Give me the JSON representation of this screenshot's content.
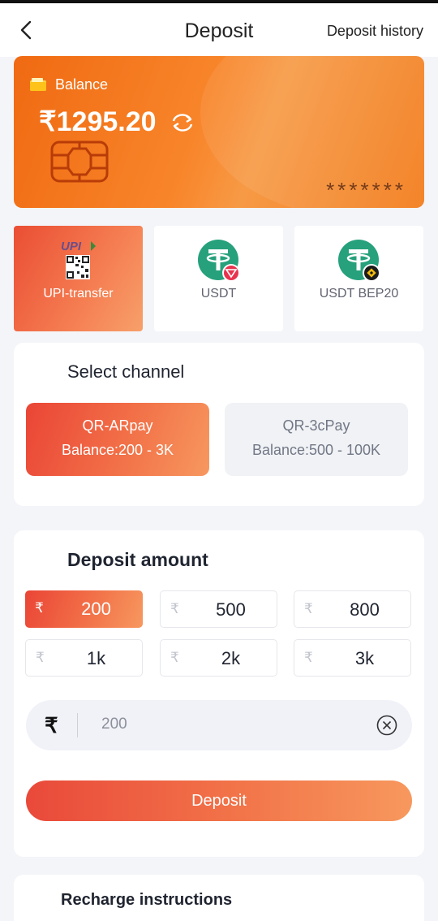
{
  "header": {
    "title": "Deposit",
    "history_label": "Deposit history"
  },
  "balance_card": {
    "label": "Balance",
    "amount": "₹1295.20",
    "masked_number": "*******"
  },
  "payment_methods": [
    {
      "label": "UPI-transfer",
      "logo_text": "UPI",
      "selected": true
    },
    {
      "label": "USDT",
      "selected": false
    },
    {
      "label": "USDT BEP20",
      "selected": false
    }
  ],
  "channel_section": {
    "title": "Select channel",
    "channels": [
      {
        "name": "QR-ARpay",
        "balance": "Balance:200 - 3K",
        "selected": true
      },
      {
        "name": "QR-3cPay",
        "balance": "Balance:500 - 100K",
        "selected": false
      }
    ]
  },
  "amount_section": {
    "title": "Deposit amount",
    "currency_symbol": "₹",
    "options": [
      {
        "value": "200",
        "selected": true
      },
      {
        "value": "500",
        "selected": false
      },
      {
        "value": "800",
        "selected": false
      },
      {
        "value": "1k",
        "selected": false
      },
      {
        "value": "2k",
        "selected": false
      },
      {
        "value": "3k",
        "selected": false
      }
    ],
    "input_value": "200",
    "submit_label": "Deposit"
  },
  "instructions": {
    "title": "Recharge instructions"
  },
  "colors": {
    "accent": "#f06a12",
    "accent_gradient_start": "#ea4536",
    "accent_gradient_end": "#f7985f",
    "tether_green": "#26a17b"
  },
  "icons": [
    "back-icon",
    "wallet-icon",
    "refresh-icon",
    "card-chip-icon",
    "upi-qr-icon",
    "usdt-trc20-icon",
    "usdt-bep20-icon",
    "clear-icon"
  ]
}
